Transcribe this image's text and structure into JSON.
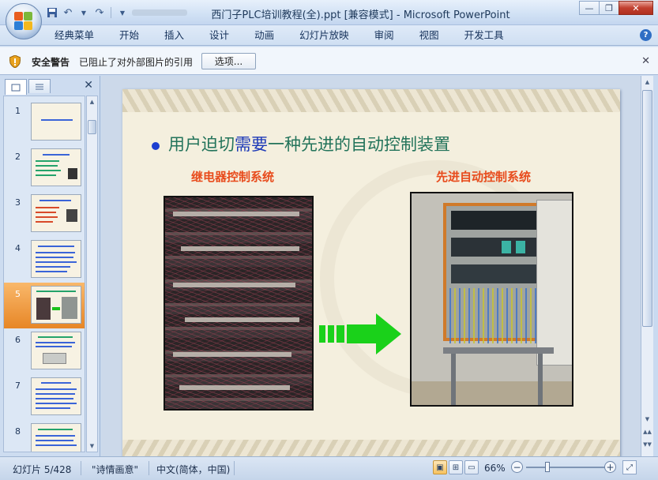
{
  "window": {
    "title": "西门子PLC培训教程(全).ppt [兼容模式] - Microsoft PowerPoint",
    "minimize": "—",
    "restore": "❐",
    "close": "✕"
  },
  "qat": {
    "save_icon": "save-icon",
    "undo_icon": "undo-icon",
    "redo_icon": "redo-icon",
    "customize_icon": "dropdown-icon"
  },
  "ribbon": {
    "tabs": [
      "经典菜单",
      "开始",
      "插入",
      "设计",
      "动画",
      "幻灯片放映",
      "审阅",
      "视图",
      "开发工具"
    ],
    "help": "?"
  },
  "security_bar": {
    "title": "安全警告",
    "message": "已阻止了对外部图片的引用",
    "button": "选项...",
    "close": "✕"
  },
  "slide_panel": {
    "close": "✕",
    "thumbnails": [
      "1",
      "2",
      "3",
      "4",
      "5",
      "6",
      "7",
      "8"
    ],
    "selected": "5"
  },
  "slide": {
    "title_part1": "用户迫切",
    "title_highlight": "需要",
    "title_part2": "一种先进的自动控制装置",
    "left_caption": "继电器控制系统",
    "right_caption": "先进自动控制系统"
  },
  "status": {
    "slide_info": "幻灯片 5/428",
    "theme": "\"诗情画意\"",
    "language": "中文(简体，中国)",
    "zoom": "66%",
    "zoom_minus": "−",
    "zoom_plus": "+"
  },
  "colors": {
    "title_green": "#22735a",
    "highlight_blue": "#1c39b8",
    "caption_red": "#e84b1c",
    "selected_thumb": "#e78626"
  }
}
